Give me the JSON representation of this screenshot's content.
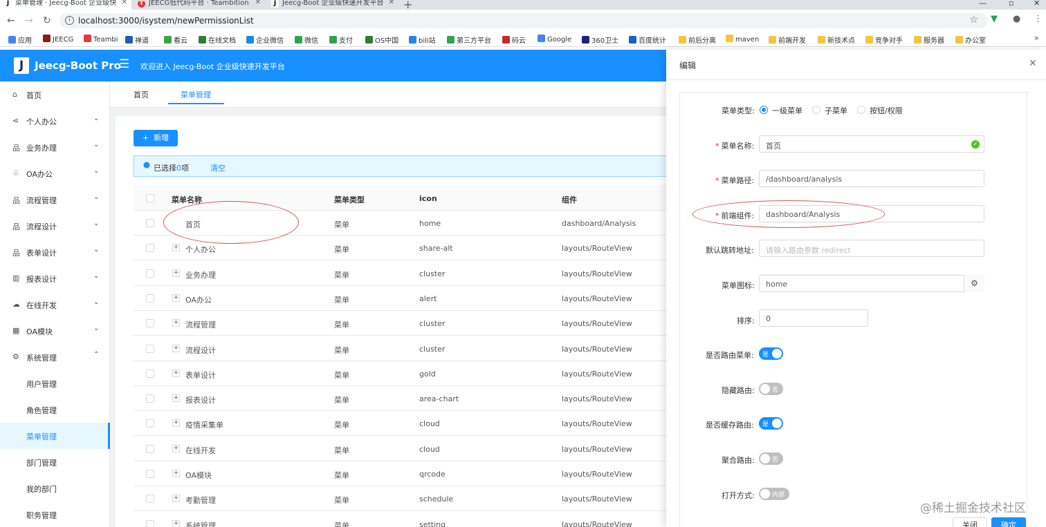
{
  "browser": {
    "tabs": [
      {
        "label": "菜单管理 · Jeecg-Boot 企业级快",
        "fav": "J"
      },
      {
        "label": "JEECG低代码平台 · Teambition",
        "fav": "T"
      },
      {
        "label": "Jeecg-Boot 企业级快速开发平台",
        "fav": "J"
      }
    ],
    "url": "localhost:3000/isystem/newPermissionList",
    "bookmarks": [
      {
        "label": "应用",
        "color": "#4285f4"
      },
      {
        "label": "JEECG",
        "color": "#8b1a1a"
      },
      {
        "label": "Teambi",
        "color": "#e53935"
      },
      {
        "label": "禅道",
        "color": "#1e5fb4"
      },
      {
        "label": "看云",
        "color": "#43a047"
      },
      {
        "label": "在线文档",
        "color": "#2e7d32"
      },
      {
        "label": "企业微信",
        "color": "#1e88e5"
      },
      {
        "label": "微信",
        "color": "#2ea44f"
      },
      {
        "label": "支付",
        "color": "#2ea44f"
      },
      {
        "label": "OS中国",
        "color": "#2e7d32"
      },
      {
        "label": "bili站",
        "color": "#1e88e5"
      },
      {
        "label": "第三方平台",
        "color": "#2ea44f"
      },
      {
        "label": "码云",
        "color": "#c62828"
      },
      {
        "label": "Google",
        "color": "#4285f4"
      },
      {
        "label": "360卫士",
        "color": "#1a237e"
      },
      {
        "label": "百度统计",
        "color": "#1565c0"
      },
      {
        "label": "前后分离",
        "color": "#f5c542"
      },
      {
        "label": "maven",
        "color": "#f5c542"
      },
      {
        "label": "前端开发",
        "color": "#f5c542"
      },
      {
        "label": "新技术点",
        "color": "#f5c542"
      },
      {
        "label": "竞争对手",
        "color": "#f5c542"
      },
      {
        "label": "服务器",
        "color": "#f5c542"
      },
      {
        "label": "办公室",
        "color": "#f5c542"
      }
    ]
  },
  "header": {
    "logo_letter": "J",
    "app_name": "Jeecg-Boot Pro",
    "welcome": "欢迎进入 Jeecg-Boot 企业级快速开发平台"
  },
  "sidebar": {
    "items": [
      {
        "label": "首页",
        "icon": "home-icon",
        "glyph": "⌂",
        "arrow": ""
      },
      {
        "label": "个人办公",
        "icon": "share-icon",
        "glyph": "⋖",
        "arrow": "⌄"
      },
      {
        "label": "业务办理",
        "icon": "cluster-icon",
        "glyph": "品",
        "arrow": "⌄"
      },
      {
        "label": "OA办公",
        "icon": "alert-icon",
        "glyph": "♧",
        "arrow": "⌄"
      },
      {
        "label": "流程管理",
        "icon": "cluster-icon",
        "glyph": "品",
        "arrow": "⌄"
      },
      {
        "label": "流程设计",
        "icon": "cluster-icon",
        "glyph": "品",
        "arrow": "⌄"
      },
      {
        "label": "表单设计",
        "icon": "gold-icon",
        "glyph": "品",
        "arrow": "⌄"
      },
      {
        "label": "报表设计",
        "icon": "area-chart-icon",
        "glyph": "▥",
        "arrow": "⌄"
      },
      {
        "label": "在线开发",
        "icon": "cloud-icon",
        "glyph": "☁",
        "arrow": "⌄"
      },
      {
        "label": "OA模块",
        "icon": "qrcode-icon",
        "glyph": "▦",
        "arrow": "⌄"
      },
      {
        "label": "系统管理",
        "icon": "setting-icon",
        "glyph": "⚙",
        "arrow": "⌃"
      },
      {
        "label": "用户管理",
        "icon": "",
        "glyph": "",
        "arrow": ""
      },
      {
        "label": "角色管理",
        "icon": "",
        "glyph": "",
        "arrow": ""
      },
      {
        "label": "菜单管理",
        "icon": "",
        "glyph": "",
        "arrow": ""
      },
      {
        "label": "部门管理",
        "icon": "",
        "glyph": "",
        "arrow": ""
      },
      {
        "label": "我的部门",
        "icon": "",
        "glyph": "",
        "arrow": ""
      },
      {
        "label": "职务管理",
        "icon": "",
        "glyph": "",
        "arrow": ""
      }
    ]
  },
  "page_tabs": [
    "首页",
    "菜单管理"
  ],
  "toolbar": {
    "add_label": "新增"
  },
  "selection": {
    "prefix": "已选择",
    "count": "0",
    "suffix": "项",
    "clear": "清空"
  },
  "table": {
    "columns": [
      "菜单名称",
      "菜单类型",
      "icon",
      "组件"
    ],
    "rows": [
      {
        "name": "首页",
        "type": "菜单",
        "icon": "home",
        "component": "dashboard/Analysis",
        "expand": false
      },
      {
        "name": "个人办公",
        "type": "菜单",
        "icon": "share-alt",
        "component": "layouts/RouteView",
        "expand": true
      },
      {
        "name": "业务办理",
        "type": "菜单",
        "icon": "cluster",
        "component": "layouts/RouteView",
        "expand": true
      },
      {
        "name": "OA办公",
        "type": "菜单",
        "icon": "alert",
        "component": "layouts/RouteView",
        "expand": true
      },
      {
        "name": "流程管理",
        "type": "菜单",
        "icon": "cluster",
        "component": "layouts/RouteView",
        "expand": true
      },
      {
        "name": "流程设计",
        "type": "菜单",
        "icon": "cluster",
        "component": "layouts/RouteView",
        "expand": true
      },
      {
        "name": "表单设计",
        "type": "菜单",
        "icon": "gold",
        "component": "layouts/RouteView",
        "expand": true
      },
      {
        "name": "报表设计",
        "type": "菜单",
        "icon": "area-chart",
        "component": "layouts/RouteView",
        "expand": true
      },
      {
        "name": "疫情采集单",
        "type": "菜单",
        "icon": "cloud",
        "component": "layouts/RouteView",
        "expand": true
      },
      {
        "name": "在线开发",
        "type": "菜单",
        "icon": "cloud",
        "component": "layouts/RouteView",
        "expand": true
      },
      {
        "name": "OA模块",
        "type": "菜单",
        "icon": "qrcode",
        "component": "layouts/RouteView",
        "expand": true
      },
      {
        "name": "考勤管理",
        "type": "菜单",
        "icon": "schedule",
        "component": "layouts/RouteView",
        "expand": true
      },
      {
        "name": "系统管理",
        "type": "菜单",
        "icon": "setting",
        "component": "layouts/RouteView",
        "expand": true
      }
    ]
  },
  "drawer": {
    "title": "编辑",
    "menu_type_label": "菜单类型:",
    "menu_type_options": [
      "一级菜单",
      "子菜单",
      "按钮/权限"
    ],
    "menu_name_label": "菜单名称:",
    "menu_name_value": "首页",
    "menu_path_label": "菜单路径:",
    "menu_path_value": "/dashboard/analysis",
    "component_label": "前端组件:",
    "component_value": "dashboard/Analysis",
    "redirect_label": "默认跳转地址:",
    "redirect_placeholder": "请输入路由参数 redirect",
    "icon_label": "菜单图标:",
    "icon_value": "home",
    "sort_label": "排序:",
    "sort_value": "0",
    "route_label": "是否路由菜单:",
    "route_value": "是",
    "hidden_label": "隐藏路由:",
    "hidden_value": "否",
    "cache_label": "是否缓存路由:",
    "cache_value": "是",
    "aggregate_label": "聚合路由:",
    "aggregate_value": "否",
    "open_label": "打开方式:",
    "open_value": "内部",
    "cancel_label": "关闭",
    "ok_label": "确定"
  },
  "watermark": "@稀土掘金技术社区"
}
